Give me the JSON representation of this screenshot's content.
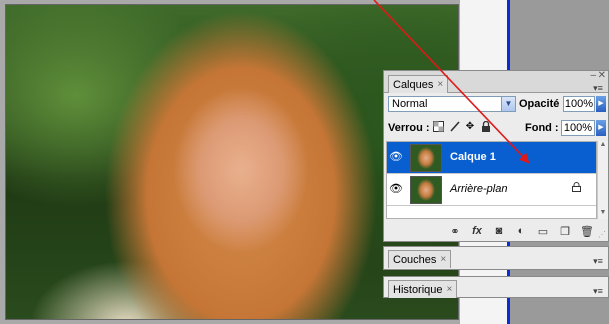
{
  "layers_panel": {
    "tab_label": "Calques",
    "tab_close": "×",
    "blend_mode": "Normal",
    "opacity_label": "Opacité :",
    "opacity_value": "100%",
    "lock_label": "Verrou :",
    "fill_label": "Fond :",
    "fill_value": "100%",
    "layers": [
      {
        "name": "Calque 1",
        "selected": true,
        "visible": true
      },
      {
        "name": "Arrière-plan",
        "selected": false,
        "visible": true,
        "locked": true
      }
    ],
    "bottom_icons": [
      "link-icon",
      "fx-icon",
      "mask-icon",
      "adjustment-icon",
      "folder-icon",
      "new-layer-icon",
      "trash-icon"
    ],
    "fx_label": "fx"
  },
  "couches_panel": {
    "tab_label": "Couches",
    "tab_close": "×"
  },
  "historique_panel": {
    "tab_label": "Historique",
    "tab_close": "×"
  },
  "colors": {
    "selection": "#0a5fd0",
    "annotation_arrow": "#e01818",
    "canvas_border": "#0a2bd6"
  }
}
